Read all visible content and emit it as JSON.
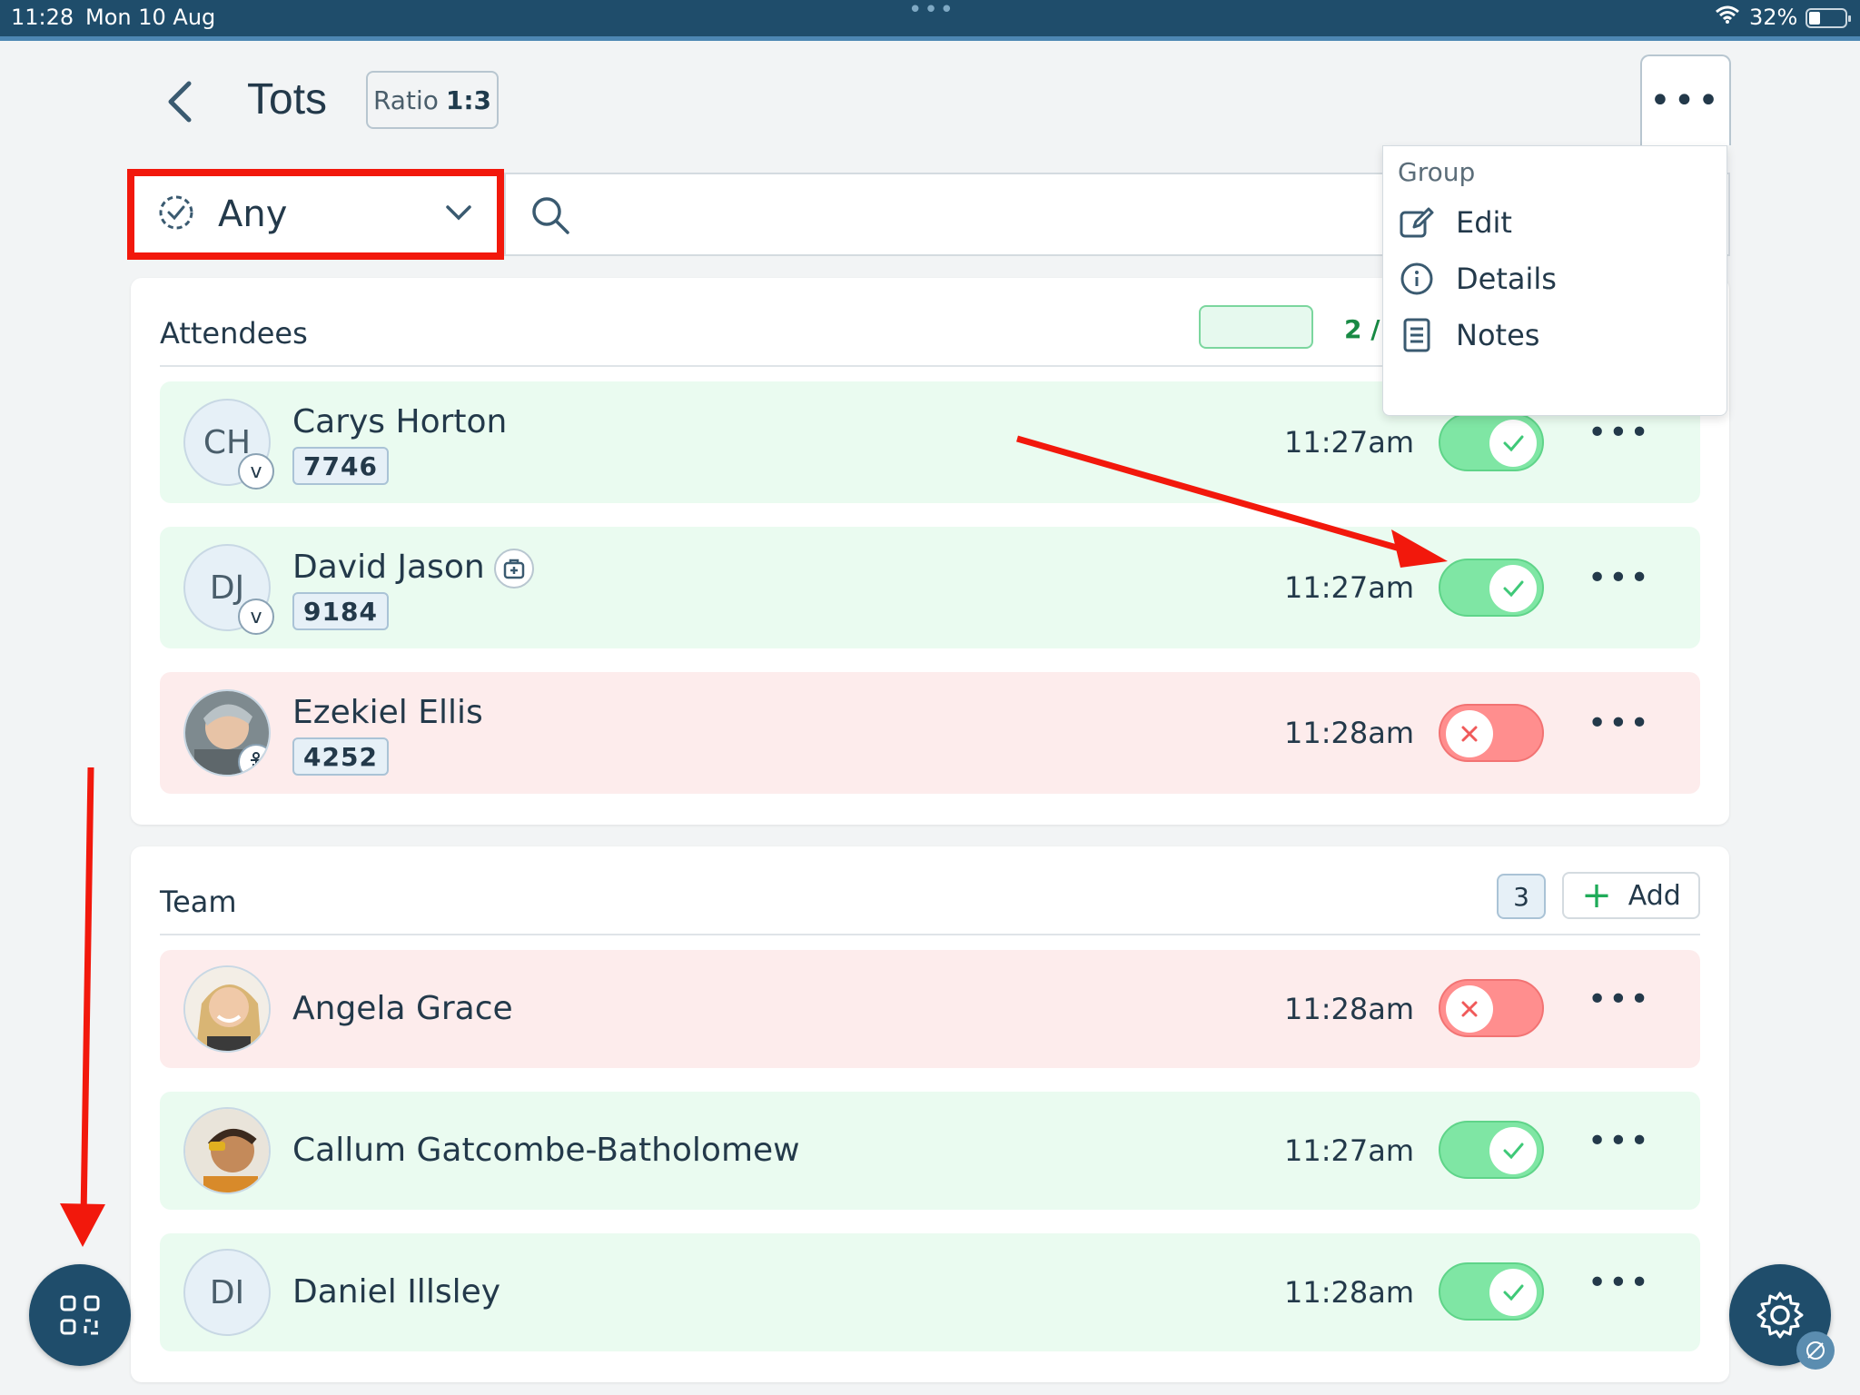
{
  "status_bar": {
    "time": "11:28",
    "date": "Mon 10 Aug",
    "battery": "32%"
  },
  "header": {
    "title": "Tots",
    "ratio_prefix": "Ratio",
    "ratio_value": "1:3"
  },
  "filter": {
    "label": "Any"
  },
  "search": {
    "placeholder": ""
  },
  "menu": {
    "heading": "Group",
    "items": [
      {
        "label": "Edit",
        "icon": "edit-icon"
      },
      {
        "label": "Details",
        "icon": "info-icon"
      },
      {
        "label": "Notes",
        "icon": "notes-icon"
      }
    ]
  },
  "attendees": {
    "title": "Attendees",
    "count_text": "2 /",
    "rows": [
      {
        "initials": "CH",
        "name": "Carys Horton",
        "id": "7746",
        "time": "11:27am",
        "status": "in",
        "badge": "v"
      },
      {
        "initials": "DJ",
        "name": "David Jason",
        "id": "9184",
        "time": "11:27am",
        "status": "in",
        "badge": "v"
      },
      {
        "initials": "",
        "name": "Ezekiel Ellis",
        "id": "4252",
        "time": "11:28am",
        "status": "out",
        "badge": ""
      }
    ]
  },
  "team": {
    "title": "Team",
    "count": "3",
    "add_label": "Add",
    "rows": [
      {
        "initials": "",
        "name": "Angela Grace",
        "time": "11:28am",
        "status": "out"
      },
      {
        "initials": "",
        "name": "Callum Gatcombe-Batholomew",
        "time": "11:27am",
        "status": "in"
      },
      {
        "initials": "DI",
        "name": "Daniel Illsley",
        "time": "11:28am",
        "status": "in"
      }
    ]
  },
  "colors": {
    "in_bg": "#eafbf0",
    "out_bg": "#fdecec",
    "toggle_on": "#7fe6a4",
    "toggle_off": "#ff8e8e",
    "brand": "#1f4d6b",
    "annotation": "#f2180c"
  }
}
